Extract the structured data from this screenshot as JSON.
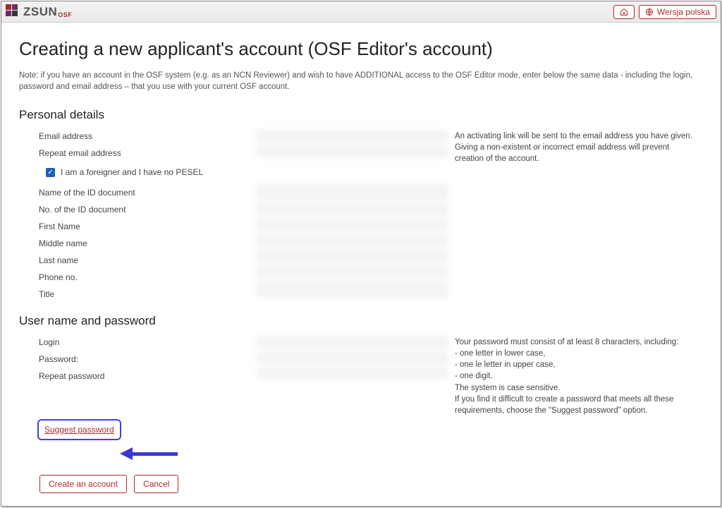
{
  "header": {
    "brand_main": "ZSUN",
    "brand_sub": "OSF",
    "lang_button": "Wersja polska"
  },
  "page": {
    "title": "Creating a new applicant's account (OSF Editor's account)",
    "note": "Note: if you have an account in the OSF system (e.g. as an NCN Reviewer) and wish to have ADDITIONAL access to the OSF Editor mode, enter below the same data - including the login, password and email address – that you use with your current OSF account."
  },
  "sections": {
    "personal": "Personal details",
    "credentials": "User name and password"
  },
  "fields": {
    "email": "Email address",
    "email_repeat": "Repeat email address",
    "foreigner_checkbox": "I am a foreigner and I have no PESEL",
    "id_doc_name": "Name of the ID document",
    "id_doc_no": "No. of the ID document",
    "first_name": "First Name",
    "middle_name": "Middle name",
    "last_name": "Last name",
    "phone": "Phone no.",
    "title": "Title",
    "login": "Login",
    "password": "Password:",
    "password_repeat": "Repeat password"
  },
  "help": {
    "email": "An activating link will be sent to the email address you have given. Giving a non-existent or incorrect email address will prevent creation of the account.",
    "password_intro": "Your password must consist of at least 8 characters, including:",
    "password_r1": "- one letter in lower case,",
    "password_r2": "- one le letter in upper case,",
    "password_r3": "- one digit.",
    "password_note1": "The system is case sensitive.",
    "password_note2": "If you find it difficult to create a password that meets all these requirements, choose the \"Suggest password\" option."
  },
  "links": {
    "suggest_password": "Suggest password"
  },
  "buttons": {
    "create": "Create an account",
    "cancel": "Cancel"
  }
}
